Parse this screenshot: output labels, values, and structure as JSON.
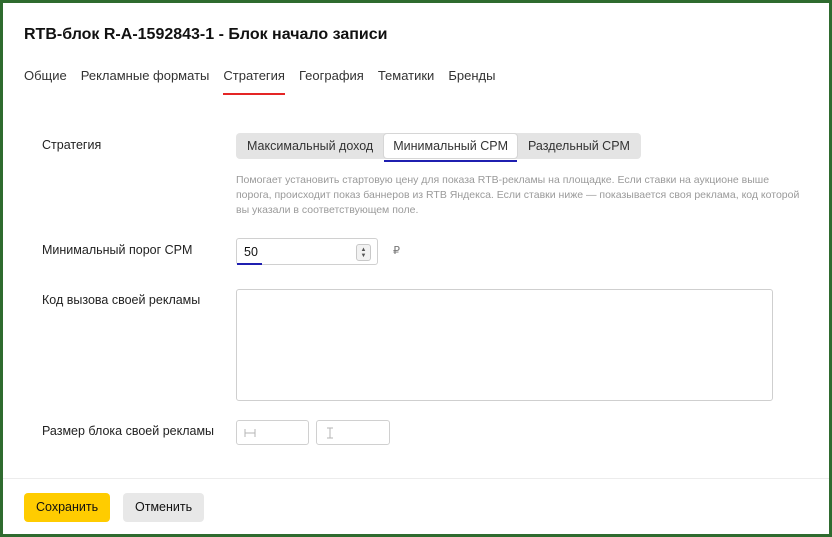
{
  "header": {
    "title": "RTB-блок R-A-1592843-1 - Блок начало записи",
    "tabs": [
      {
        "label": "Общие"
      },
      {
        "label": "Рекламные форматы"
      },
      {
        "label": "Стратегия"
      },
      {
        "label": "География"
      },
      {
        "label": "Тематики"
      },
      {
        "label": "Бренды"
      }
    ],
    "active_tab": "Стратегия"
  },
  "strategy": {
    "label": "Стратегия",
    "options": [
      {
        "label": "Максимальный доход"
      },
      {
        "label": "Минимальный CPM"
      },
      {
        "label": "Раздельный CPM"
      }
    ],
    "selected": "Минимальный CPM",
    "hint": "Помогает установить стартовую цену для показа RTB-рекламы на площадке. Если ставки на аукционе выше порога, происходит показ баннеров из RTB Яндекса. Если ставки ниже — показывается своя реклама, код которой вы указали в соответствующем поле."
  },
  "min_cpm": {
    "label": "Минимальный порог CPM",
    "value": "50",
    "currency": "₽"
  },
  "own_ad_code": {
    "label": "Код вызова своей рекламы",
    "value": ""
  },
  "own_ad_size": {
    "label": "Размер блока своей рекламы",
    "width_icon": "width-arrows-icon",
    "height_icon": "height-arrows-icon"
  },
  "footer": {
    "save_label": "Сохранить",
    "cancel_label": "Отменить"
  },
  "colors": {
    "accent_yellow": "#ffcc00",
    "active_tab_underline": "#e42525",
    "focus_underline": "#1f1fb0",
    "frame_border": "#2f6b2f"
  }
}
